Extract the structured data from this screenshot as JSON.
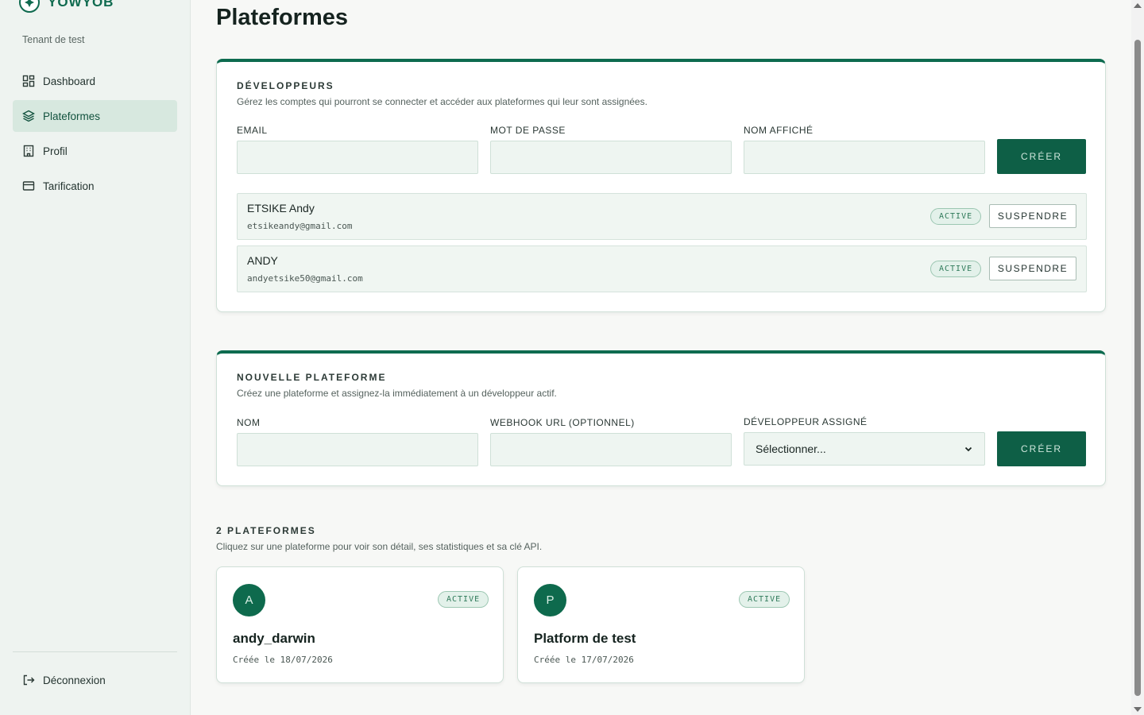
{
  "brand": {
    "name": "YOWYOB",
    "tenant": "Tenant de test"
  },
  "sidebar": {
    "items": [
      {
        "label": "Dashboard",
        "icon": "dashboard-grid-icon"
      },
      {
        "label": "Plateformes",
        "icon": "layers-icon",
        "active": true
      },
      {
        "label": "Profil",
        "icon": "building-icon"
      },
      {
        "label": "Tarification",
        "icon": "credit-card-icon"
      }
    ],
    "logout": {
      "label": "Déconnexion",
      "icon": "logout-icon"
    }
  },
  "page": {
    "title": "Plateformes"
  },
  "developers": {
    "title": "DÉVELOPPEURS",
    "description": "Gérez les comptes qui pourront se connecter et accéder aux plateformes qui leur sont assignées.",
    "fields": {
      "email_label": "EMAIL",
      "password_label": "MOT DE PASSE",
      "display_name_label": "NOM AFFICHÉ"
    },
    "create_label": "CRÉER",
    "list": [
      {
        "name": "ETSIKE Andy",
        "email": "etsikeandy@gmail.com",
        "status": "ACTIVE",
        "action": "SUSPENDRE"
      },
      {
        "name": "ANDY",
        "email": "andyetsike50@gmail.com",
        "status": "ACTIVE",
        "action": "SUSPENDRE"
      }
    ]
  },
  "new_platform": {
    "title": "NOUVELLE PLATEFORME",
    "description": "Créez une plateforme et assignez-la immédiatement à un développeur actif.",
    "fields": {
      "name_label": "NOM",
      "webhook_label": "WEBHOOK URL (OPTIONNEL)",
      "developer_label": "DÉVELOPPEUR ASSIGNÉ",
      "developer_selected": "Sélectionner..."
    },
    "create_label": "CRÉER"
  },
  "platforms": {
    "title": "2 PLATEFORMES",
    "description": "Cliquez sur une plateforme pour voir son détail, ses statistiques et sa clé API.",
    "items": [
      {
        "initial": "A",
        "name": "andy_darwin",
        "status": "ACTIVE",
        "created": "Créée le 18/07/2026"
      },
      {
        "initial": "P",
        "name": "Platform de test",
        "status": "ACTIVE",
        "created": "Créée le 17/07/2026"
      }
    ]
  },
  "colors": {
    "accent": "#0e5f46",
    "badge_bg": "#e3f1ea",
    "sidebar_bg": "#eef3f0"
  }
}
